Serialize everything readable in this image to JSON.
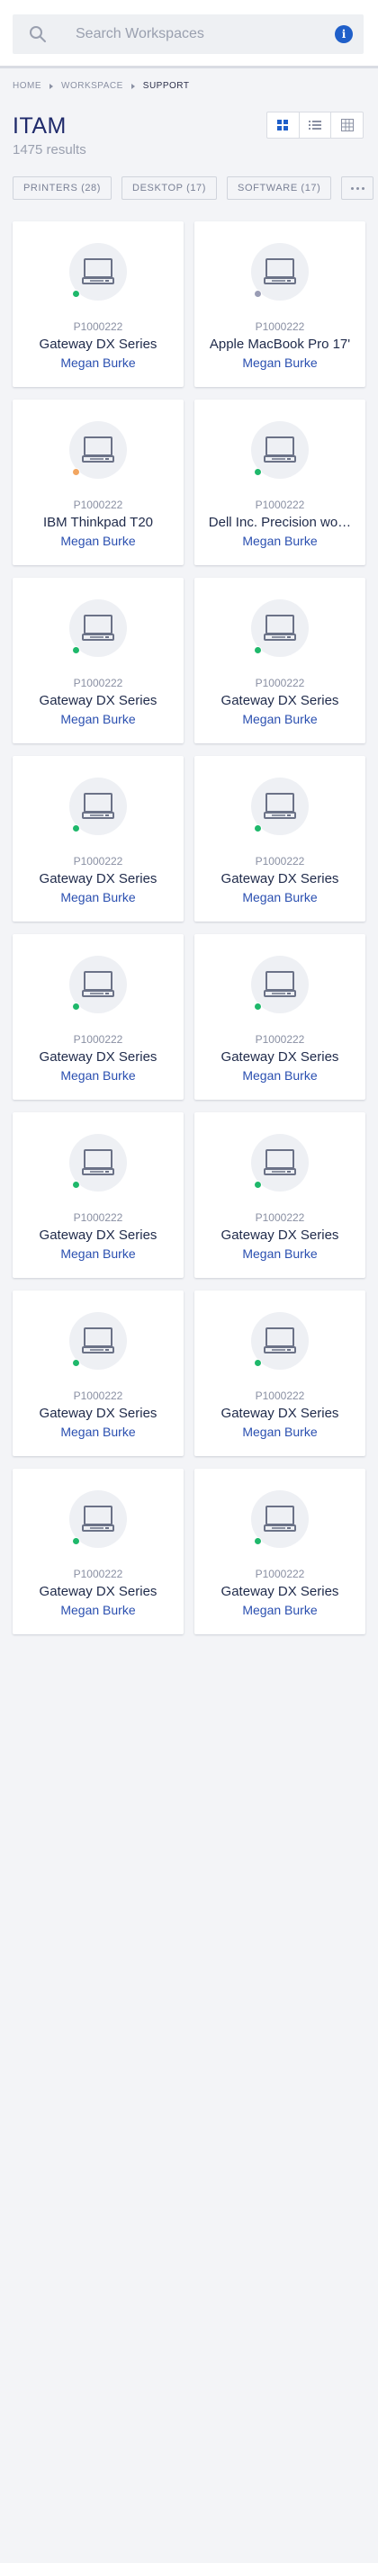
{
  "search": {
    "placeholder": "Search Workspaces",
    "info_icon": "info-icon",
    "info_glyph": "i"
  },
  "breadcrumb": [
    "HOME",
    "WORKSPACE",
    "SUPPORT"
  ],
  "page": {
    "title": "ITAM",
    "results": "1475 results"
  },
  "view_modes": {
    "active": "grid",
    "options": [
      "grid-view-icon",
      "list-view-icon",
      "table-view-icon"
    ]
  },
  "filters": [
    "PRINTERS (28)",
    "DESKTOP (17)",
    "SOFTWARE (17)"
  ],
  "colors": {
    "accent": "#1f5fc9",
    "online": "#1fb86b",
    "offline": "#9a9db5",
    "warning": "#f2a661",
    "owner_link": "#2a4fb0"
  },
  "assets": [
    {
      "id": "P1000222",
      "name": "Gateway DX Series",
      "owner": "Megan Burke",
      "status": "online",
      "status_color": "#1fb86b",
      "icon": "laptop-icon"
    },
    {
      "id": "P1000222",
      "name": "Apple MacBook Pro 17'",
      "owner": "Megan Burke",
      "status": "offline",
      "status_color": "#9a9db5",
      "icon": "laptop-icon"
    },
    {
      "id": "P1000222",
      "name": "IBM Thinkpad T20",
      "owner": "Megan Burke",
      "status": "warning",
      "status_color": "#f2a661",
      "icon": "laptop-icon"
    },
    {
      "id": "P1000222",
      "name": "Dell Inc. Precision wo…",
      "owner": "Megan Burke",
      "status": "online",
      "status_color": "#1fb86b",
      "icon": "laptop-icon"
    },
    {
      "id": "P1000222",
      "name": "Gateway DX Series",
      "owner": "Megan Burke",
      "status": "online",
      "status_color": "#1fb86b",
      "icon": "laptop-icon"
    },
    {
      "id": "P1000222",
      "name": "Gateway DX Series",
      "owner": "Megan Burke",
      "status": "online",
      "status_color": "#1fb86b",
      "icon": "laptop-icon"
    },
    {
      "id": "P1000222",
      "name": "Gateway DX Series",
      "owner": "Megan Burke",
      "status": "online",
      "status_color": "#1fb86b",
      "icon": "laptop-icon"
    },
    {
      "id": "P1000222",
      "name": "Gateway DX Series",
      "owner": "Megan Burke",
      "status": "online",
      "status_color": "#1fb86b",
      "icon": "laptop-icon"
    },
    {
      "id": "P1000222",
      "name": "Gateway DX Series",
      "owner": "Megan Burke",
      "status": "online",
      "status_color": "#1fb86b",
      "icon": "laptop-icon"
    },
    {
      "id": "P1000222",
      "name": "Gateway DX Series",
      "owner": "Megan Burke",
      "status": "online",
      "status_color": "#1fb86b",
      "icon": "laptop-icon"
    },
    {
      "id": "P1000222",
      "name": "Gateway DX Series",
      "owner": "Megan Burke",
      "status": "online",
      "status_color": "#1fb86b",
      "icon": "laptop-icon"
    },
    {
      "id": "P1000222",
      "name": "Gateway DX Series",
      "owner": "Megan Burke",
      "status": "online",
      "status_color": "#1fb86b",
      "icon": "laptop-icon"
    },
    {
      "id": "P1000222",
      "name": "Gateway DX Series",
      "owner": "Megan Burke",
      "status": "online",
      "status_color": "#1fb86b",
      "icon": "laptop-icon"
    },
    {
      "id": "P1000222",
      "name": "Gateway DX Series",
      "owner": "Megan Burke",
      "status": "online",
      "status_color": "#1fb86b",
      "icon": "laptop-icon"
    },
    {
      "id": "P1000222",
      "name": "Gateway DX Series",
      "owner": "Megan Burke",
      "status": "online",
      "status_color": "#1fb86b",
      "icon": "laptop-icon"
    },
    {
      "id": "P1000222",
      "name": "Gateway DX Series",
      "owner": "Megan Burke",
      "status": "online",
      "status_color": "#1fb86b",
      "icon": "laptop-icon"
    }
  ]
}
